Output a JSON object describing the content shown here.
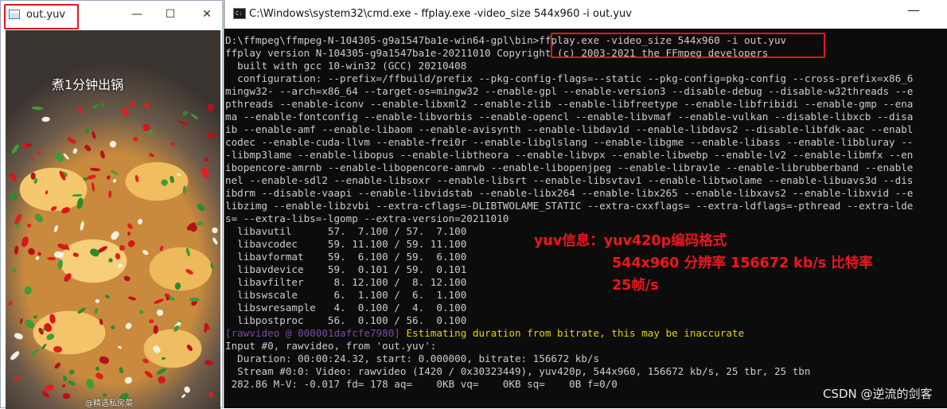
{
  "left_window": {
    "title": "out.yuv",
    "video_caption": "煮1分钟出锅",
    "watermark": "@精选私房菜"
  },
  "cmd_window": {
    "title": "C:\\Windows\\system32\\cmd.exe - ffplay.exe  -video_size 544x960 -i out.yuv",
    "lines": [
      "D:\\ffmpeg\\ffmpeg-N-104305-g9a1547ba1e-win64-gpl\\bin>ffplay.exe -video_size 544x960 -i out.yuv",
      "ffplay version N-104305-g9a1547ba1e-20211010 Copyright (c) 2003-2021 the FFmpeg developers",
      "  built with gcc 10-win32 (GCC) 20210408",
      "  configuration: --prefix=/ffbuild/prefix --pkg-config-flags=--static --pkg-config=pkg-config --cross-prefix=x86_6",
      "mingw32- --arch=x86_64 --target-os=mingw32 --enable-gpl --enable-version3 --disable-debug --disable-w32threads --e",
      "pthreads --enable-iconv --enable-libxml2 --enable-zlib --enable-libfreetype --enable-libfribidi --enable-gmp --ena",
      "ma --enable-fontconfig --enable-libvorbis --enable-opencl --enable-libvmaf --enable-vulkan --disable-libxcb --disa",
      "ib --enable-amf --enable-libaom --enable-avisynth --enable-libdav1d --enable-libdavs2 --disable-libfdk-aac --enabl",
      "codec --enable-cuda-llvm --enable-frei0r --enable-libglslang --enable-libgme --enable-libass --enable-libbluray --",
      "-libmp3lame --enable-libopus --enable-libtheora --enable-libvpx --enable-libwebp --enable-lv2 --enable-libmfx --en",
      "ibopencore-amrnb --enable-libopencore-amrwb --enable-libopenjpeg --enable-librav1e --enable-librubberband --enable",
      "nel --enable-sdl2 --enable-libsoxr --enable-libsrt --enable-libsvtav1 --enable-libtwolame --enable-libuavs3d --dis",
      "ibdrm --disable-vaapi --enable-libvidstab --enable-libx264 --enable-libx265 --enable-libxavs2 --enable-libxvid --e",
      "libzimg --enable-libzvbi --extra-cflags=-DLIBTWOLAME_STATIC --extra-cxxflags= --extra-ldflags=-pthread --extra-lde",
      "s= --extra-libs=-lgomp --extra-version=20211010",
      "  libavutil      57.  7.100 / 57.  7.100",
      "  libavcodec     59. 11.100 / 59. 11.100",
      "  libavformat    59.  6.100 / 59.  6.100",
      "  libavdevice    59.  0.101 / 59.  0.101",
      "  libavfilter     8. 12.100 /  8. 12.100",
      "  libswscale      6.  1.100 /  6.  1.100",
      "  libswresample   4.  0.100 /  4.  0.100",
      "  libpostproc    56.  0.100 / 56.  0.100"
    ],
    "warning_tag": "[rawvideo @ 000001dafcfe7980]",
    "warning_text": " Estimating duration from bitrate, this may be inaccurate",
    "lines_after": [
      "Input #0, rawvideo, from 'out.yuv':",
      "  Duration: 00:00:24.32, start: 0.000000, bitrate: 156672 kb/s",
      "  Stream #0:0: Video: rawvideo (I420 / 0x30323449), yuv420p, 544x960, 156672 kb/s, 25 tbr, 25 tbn",
      " 282.86 M-V: -0.017 fd= 178 aq=    0KB vq=    0KB sq=    0B f=0/0"
    ]
  },
  "annotation": {
    "line1": "yuv信息：yuv420p编码格式",
    "line2": "544x960 分辨率 156672 kb/s 比特率",
    "line3": "25帧/s"
  },
  "csdn_watermark": "CSDN @逆流的剑客",
  "icons": {
    "minimize": "—",
    "maximize": "☐",
    "close": "✕"
  },
  "colors": {
    "highlight_box": "#e8141c",
    "annotation_text": "#f0141e",
    "console_text": "#cccccc",
    "warning_text": "#e3d300",
    "warning_tag": "#7b4a9c"
  }
}
